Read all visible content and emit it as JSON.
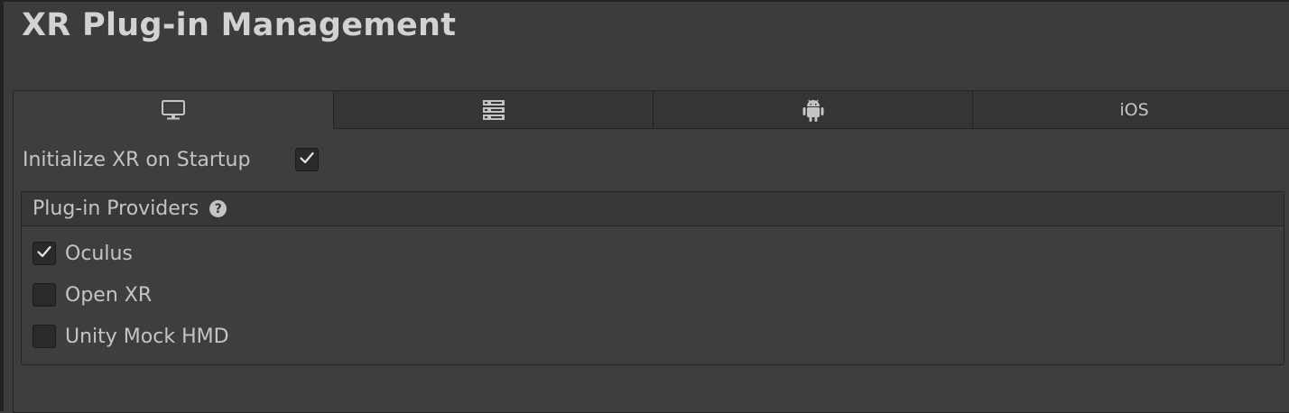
{
  "window": {
    "title": "XR Plug-in Management"
  },
  "tabs": [
    {
      "icon": "monitor-icon",
      "label": "",
      "selected": true
    },
    {
      "icon": "server-icon",
      "label": "",
      "selected": false
    },
    {
      "icon": "android-icon",
      "label": "",
      "selected": false
    },
    {
      "icon": "",
      "label": "iOS",
      "selected": false
    }
  ],
  "settings": {
    "init_label": "Initialize XR on Startup",
    "init_checked": true
  },
  "providers": {
    "header": "Plug-in Providers",
    "help_glyph": "?",
    "items": [
      {
        "label": "Oculus",
        "checked": true
      },
      {
        "label": "Open XR",
        "checked": false
      },
      {
        "label": "Unity Mock HMD",
        "checked": false
      }
    ]
  },
  "colors": {
    "background": "#3c3c3c",
    "tab_inactive": "#353535",
    "text": "#c4c4c4",
    "border": "#232323"
  }
}
